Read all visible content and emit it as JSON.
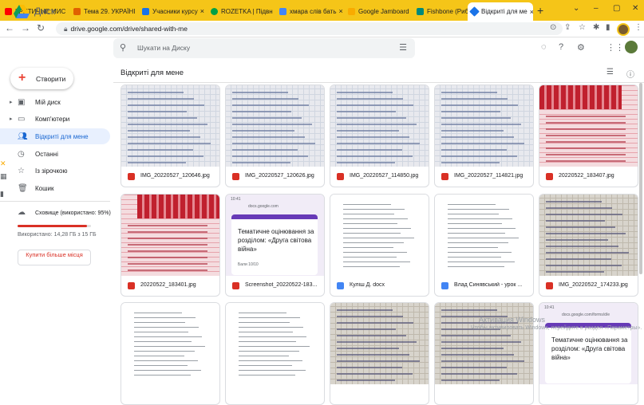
{
  "browser": {
    "tabs": [
      {
        "label": "КРИТИЧНЕ МИС",
        "color": "#ff0000"
      },
      {
        "label": "Тема 29. УКРАЇНІ",
        "color": "#e06000"
      },
      {
        "label": "Учасники курсу",
        "color": "#1a73e8"
      },
      {
        "label": "ROZETKA | Підвн",
        "color": "#00a046"
      },
      {
        "label": "хмара слів бать",
        "color": "#4285f4"
      },
      {
        "label": "Google Jamboard",
        "color": "#f9ab00"
      },
      {
        "label": "Fishbone (Рибни",
        "color": "#00897b"
      },
      {
        "label": "Відкриті для ме",
        "color": "#1a73e8"
      }
    ],
    "url": "drive.google.com/drive/shared-with-me"
  },
  "app": {
    "name": "Диск",
    "search_placeholder": "Шукати на Диску"
  },
  "sidebar": {
    "create_label": "Створити",
    "items": [
      {
        "label": "Мій диск",
        "icon": "drive-icon"
      },
      {
        "label": "Комп'ютери",
        "icon": "computer-icon"
      },
      {
        "label": "Відкриті для мене",
        "icon": "people-icon"
      },
      {
        "label": "Останні",
        "icon": "clock-icon"
      },
      {
        "label": "Із зірочкою",
        "icon": "star-icon"
      },
      {
        "label": "Кошик",
        "icon": "trash-icon"
      }
    ],
    "storage_label": "Сховище (використано: 95%)",
    "storage_fraction": 0.95,
    "storage_text": "Використано: 14,28 ГБ з 15 ГБ",
    "buy_label": "Купити більше місця"
  },
  "main": {
    "title": "Відкриті для мене",
    "files": [
      {
        "name": "IMG_20220527_120646.jpg",
        "type": "image",
        "thumb": "paper"
      },
      {
        "name": "IMG_20220527_120626.jpg",
        "type": "image",
        "thumb": "paper"
      },
      {
        "name": "IMG_20220527_114850.jpg",
        "type": "image",
        "thumb": "paper"
      },
      {
        "name": "IMG_20220527_114821.jpg",
        "type": "image",
        "thumb": "paper"
      },
      {
        "name": "20220522_183407.jpg",
        "type": "image",
        "thumb": "pink"
      },
      {
        "name": "20220522_183401.jpg",
        "type": "image",
        "thumb": "pink"
      },
      {
        "name": "Screenshot_20220522-183...",
        "type": "image",
        "thumb": "form"
      },
      {
        "name": "Куліш Д. docx",
        "type": "doc",
        "thumb": "doc"
      },
      {
        "name": "Влад Синявський - урок ...",
        "type": "doc",
        "thumb": "doc"
      },
      {
        "name": "IMG_20220522_174233.jpg",
        "type": "image",
        "thumb": "paperwarm"
      },
      {
        "name": "",
        "type": "doc",
        "thumb": "doc"
      },
      {
        "name": "",
        "type": "doc",
        "thumb": "doc"
      },
      {
        "name": "",
        "type": "image",
        "thumb": "paperwarm"
      },
      {
        "name": "",
        "type": "image",
        "thumb": "paperwarm"
      },
      {
        "name": "",
        "type": "image",
        "thumb": "form2"
      }
    ],
    "form_title": "Тематичне оцінювання за розділом: «Друга світова війна»",
    "form_time": "10:41",
    "form_url": "docs.google.com",
    "form_url2": "docs.google.com/forms/d/e",
    "form_points": "Бали 10/10"
  },
  "windows_watermark": {
    "line1": "Активация Windows",
    "line2": "Чтобы активировать Windows, перейдите в раздел «Параметры»."
  }
}
